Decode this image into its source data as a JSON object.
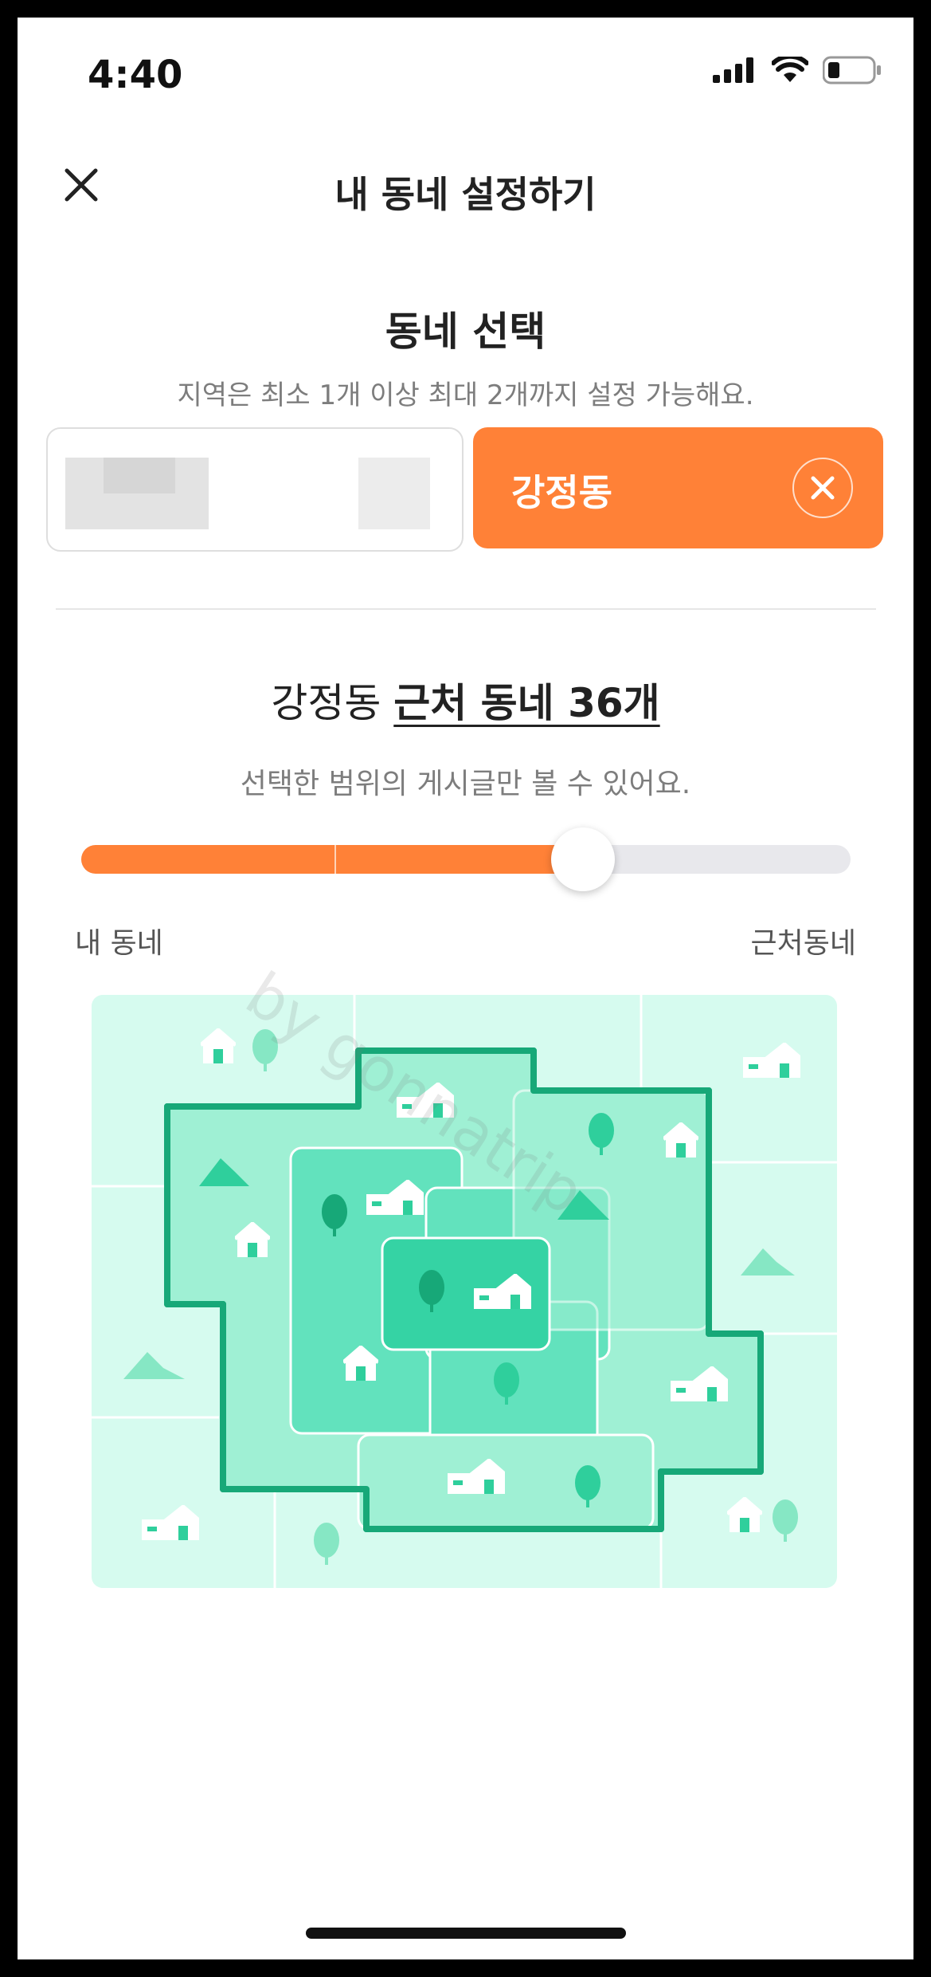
{
  "status_bar": {
    "time": "4:40"
  },
  "header": {
    "title": "내 동네 설정하기",
    "close_icon": "close-icon"
  },
  "neighborhood_select": {
    "title": "동네 선택",
    "subtitle": "지역은 최소 1개 이상 최대 2개까지 설정 가능해요.",
    "selected_chip": {
      "label": "강정동",
      "icon": "close-circle-icon"
    }
  },
  "nearby": {
    "prefix": "강정동 ",
    "highlight": "근처 동네 36개",
    "subtitle": "선택한 범위의 게시글만 볼 수 있어요.",
    "slider": {
      "level_fraction": 0.65,
      "left_label": "내 동네",
      "right_label": "근처동네"
    }
  },
  "watermark": "by gonnatrip",
  "colors": {
    "accent": "#ff8137",
    "map_light": "#d6fbef",
    "map_mid": "#9ff0d4",
    "map_dark": "#62e2bd",
    "map_core": "#35d3a4",
    "map_border": "#17a878"
  }
}
